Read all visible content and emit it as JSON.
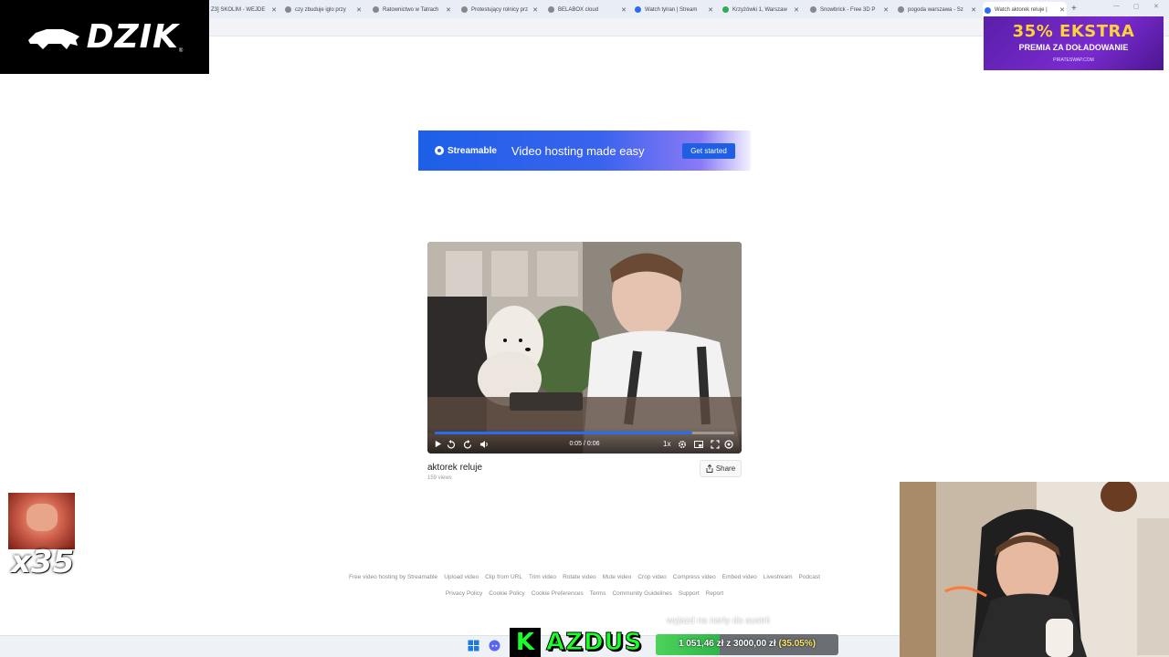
{
  "browser": {
    "tabs": [
      {
        "label": "Z3] SKOLIM - WEJDE"
      },
      {
        "label": "czy zbuduje iglo przy"
      },
      {
        "label": "Ratownictwo w Tatrach"
      },
      {
        "label": "Protestujący rolnicy prz"
      },
      {
        "label": "BELABOX cloud"
      },
      {
        "label": "Watch tylran | Stream"
      },
      {
        "label": "Krzyżówki 1, Warszaw"
      },
      {
        "label": "Snowbrick - Free 3D P"
      },
      {
        "label": "pogoda warszawa - Sz"
      },
      {
        "label": "Watch aktorek reluje |"
      }
    ],
    "new_tab": "+"
  },
  "overlay": {
    "brand": "DZIK",
    "brand_mark": "®",
    "promo_big": "35% EKSTRA",
    "promo_sub": "PREMIA ZA DOŁADOWANIE",
    "promo_url": "PIRATESWAP.COM",
    "emote_count": "x35",
    "caption": "wyjazd na narty do austrii",
    "donor_letter": "K",
    "donor_name": "AZDUS",
    "goal": {
      "current": "1 051,46 zł",
      "sep": "z",
      "target": "3000,00 zł",
      "percent": "(35.05%)",
      "fraction": 0.3505
    }
  },
  "ad": {
    "brand": "Streamable",
    "tagline": "Video hosting made easy",
    "cta": "Get started"
  },
  "video": {
    "time": "0:05 / 0:06",
    "progress": 0.86,
    "speed": "1x",
    "title": "aktorek reluje",
    "views": "159 views",
    "share": "Share"
  },
  "footer": {
    "row1": [
      "Free video hosting by Streamable",
      "Upload video",
      "Clip from URL",
      "Trim video",
      "Rotate video",
      "Mute video",
      "Crop video",
      "Compress video",
      "Embed video",
      "Livestream",
      "Podcast"
    ],
    "row2": [
      "Privacy Policy",
      "Cookie Policy",
      "Cookie Preferences",
      "Terms",
      "Community Guidelines",
      "Support",
      "Report"
    ]
  },
  "colors": {
    "accent": "#2a6cf0",
    "promo_yellow": "#ffd23a",
    "donor_green": "#1aff2c"
  }
}
